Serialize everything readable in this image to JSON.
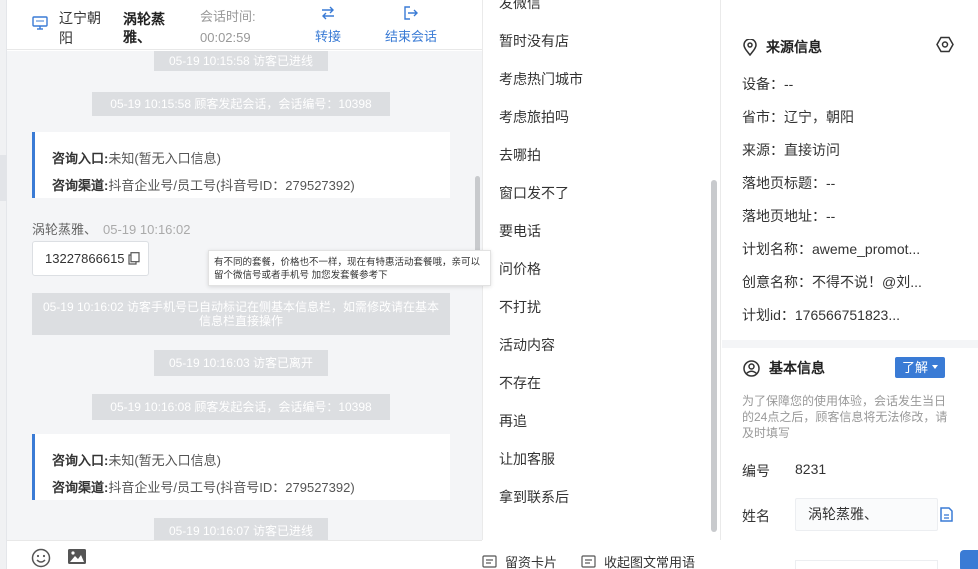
{
  "header": {
    "location": "辽宁朝阳",
    "visitor_name": "涡轮蒸雅、",
    "session_time_label": "会话时间:",
    "session_time": "00:02:59",
    "transfer_label": "转接",
    "end_session_label": "结束会话"
  },
  "chat": {
    "messages": [
      "05-19 10:15:58 访客已进线",
      "05-19 10:15:58 顾客发起会话，会话编号：10398",
      "05-19 10:16:02 访客手机号已自动标记在侧基本信息栏，如需修改请在基本信息栏直接操作",
      "05-19 10:16:03 访客已离开",
      "05-19 10:16:08 顾客发起会话，会话编号：10398",
      "05-19 10:16:07 访客已进线"
    ],
    "card1": {
      "entry_label": "咨询入口:",
      "entry_value": "未知(暂无入口信息)",
      "channel_label": "咨询渠道:",
      "channel_value": "抖音企业号/员工号(抖音号ID：279527392)"
    },
    "card2": {
      "entry_label": "咨询入口:",
      "entry_value": "未知(暂无入口信息)",
      "channel_label": "咨询渠道:",
      "channel_value": "抖音企业号/员工号(抖音号ID：279527392)"
    },
    "visitor": {
      "name": "涡轮蒸雅、",
      "time": "05-19 10:16:02",
      "phone": "13227866615"
    },
    "tooltip": "有不同的套餐，价格也不一样，现在有特惠活动套餐哦，亲可以留个微信号或者手机号 加您发套餐参考下"
  },
  "quick_replies": {
    "items": [
      "发微信",
      "暂时没有店",
      "考虑热门城市",
      "考虑旅拍吗",
      "去哪拍",
      "窗口发不了",
      "要电话",
      "问价格",
      "不打扰",
      "活动内容",
      "不存在",
      "再追",
      "让加客服",
      "拿到联系后"
    ],
    "footer_card_label": "留资卡片",
    "footer_collapse_label": "收起图文常用语"
  },
  "source_info": {
    "title": "来源信息",
    "rows": [
      "设备：--",
      "省市：辽宁，朝阳",
      "来源：直接访问",
      "落地页标题：--",
      "落地页地址：--",
      "计划名称：aweme_promot...",
      "创意名称：不得不说！@刘...",
      "计划id：176566751823..."
    ]
  },
  "basic_info": {
    "title": "基本信息",
    "learn_label": "了解",
    "notice": "为了保障您的使用体验，会话发生当日的24点之后，顾客信息将无法修改，请及时填写",
    "id_label": "编号",
    "id_value": "8231",
    "name_label": "姓名",
    "name_value": "涡轮蒸雅、"
  },
  "colors": {
    "accent": "#3a7bd5",
    "system_message_bg": "#dcdee1",
    "chat_bg": "#f4f5f7"
  }
}
